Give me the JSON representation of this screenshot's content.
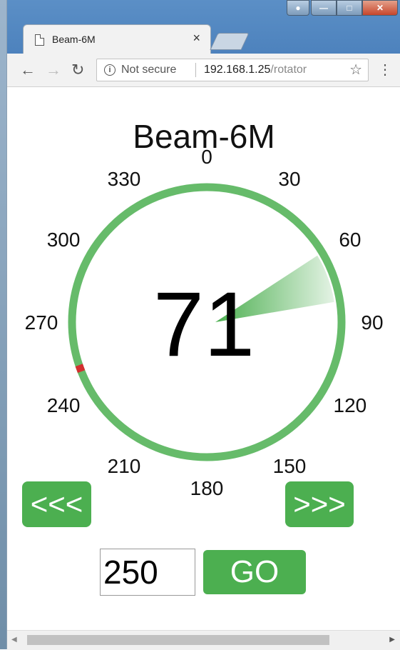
{
  "browser": {
    "tab_title": "Beam-6M",
    "tab_close": "×",
    "security_label": "Not secure",
    "url_host": "192.168.1.25",
    "url_path": "/rotator",
    "icons": [
      "page-icon",
      "close-icon",
      "back-icon",
      "forward-icon",
      "reload-icon",
      "info-icon",
      "star-icon",
      "menu-icon"
    ]
  },
  "page": {
    "title": "Beam-6M",
    "current_heading": "71",
    "target_heading": 71,
    "stop_marker_deg": 250,
    "ccw_button": "<<<",
    "cw_button": ">>>",
    "heading_input_value": "250",
    "go_button": "GO",
    "dial_labels": [
      "0",
      "30",
      "60",
      "90",
      "120",
      "150",
      "180",
      "210",
      "240",
      "270",
      "300",
      "330"
    ],
    "colors": {
      "ring": "#66bb6a",
      "beam": "#4caf50",
      "stop_marker": "#d32f2f",
      "button": "#4caf50"
    }
  }
}
